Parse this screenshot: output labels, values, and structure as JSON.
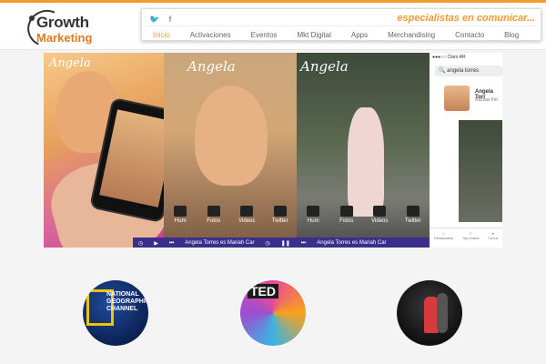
{
  "header": {
    "logo": {
      "line1": "Growth",
      "line2": "Marketing"
    },
    "tagline": "especialistas en comunicar...",
    "social": [
      {
        "icon": "twitter-icon",
        "glyph": "🐦"
      },
      {
        "icon": "facebook-icon",
        "glyph": "f"
      }
    ],
    "nav": [
      {
        "label": "Inicio",
        "active": true
      },
      {
        "label": "Activaciones"
      },
      {
        "label": "Eventos"
      },
      {
        "label": "Mkt Digital"
      },
      {
        "label": "Apps"
      },
      {
        "label": "Merchandising"
      },
      {
        "label": "Contacto"
      },
      {
        "label": "Blog"
      }
    ]
  },
  "banner": {
    "brand": "Angela",
    "icons": [
      "Hum",
      "Fotos",
      "Videos",
      "Twitter"
    ],
    "player_text": "Angela Torres es Mariah Car",
    "search_query": "angela torres",
    "status": "●●●○○ Claro AR",
    "result_name": "Angela Torr",
    "result_sub": "Nicolas Fer",
    "tabs": [
      "Destacados",
      "Top charts",
      "Cerca"
    ]
  },
  "circles": [
    {
      "label": "NATIONAL GEOGRAPHIC CHANNEL"
    },
    {
      "label": "TED"
    },
    {
      "label": ""
    }
  ],
  "colors": {
    "accent": "#f39a33",
    "player": "#3a2f8a"
  }
}
